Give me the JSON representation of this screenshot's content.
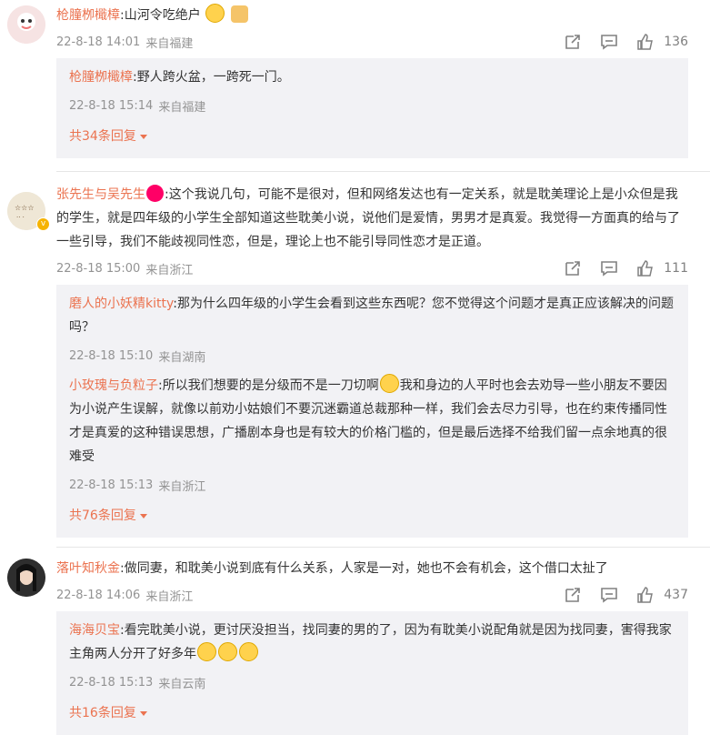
{
  "threads": [
    {
      "author": "枪膧栁檝樟",
      "body": ":山河令吃绝户",
      "time": "22-8-18 14:01",
      "source": "来自福建",
      "likes": "136",
      "avatar_color": "#f3d9d9",
      "replies": [
        {
          "author": "枪膧栁檝樟",
          "body": ":野人跨火盆，一跨死一门。",
          "time": "22-8-18 15:14",
          "source": "来自福建"
        }
      ],
      "more": "共34条回复"
    },
    {
      "author": "张先生与吴先生",
      "body": ":这个我说几句，可能不是很对，但和网络发达也有一定关系，就是耽美理论上是小众但是我的学生，就是四年级的小学生全部知道这些耽美小说，说他们是爱情，男男才是真爱。我觉得一方面真的给与了一些引导，我们不能歧视同性恋，但是，理论上也不能引导同性恋才是正道。",
      "time": "22-8-18 15:00",
      "source": "来自浙江",
      "likes": "111",
      "avatar_color": "#e8e0d0",
      "replies": [
        {
          "author": "磨人的小妖精kitty",
          "body": ":那为什么四年级的小学生会看到这些东西呢？您不觉得这个问题才是真正应该解决的问题吗？",
          "time": "22-8-18 15:10",
          "source": "来自湖南"
        },
        {
          "author": "小玫瑰与负粒子",
          "body": ":所以我们想要的是分级而不是一刀切啊",
          "body2": "我和身边的人平时也会去劝导一些小朋友不要因为小说产生误解，就像以前劝小姑娘们不要沉迷霸道总裁那种一样，我们会去尽力引导，也在约束传播同性才是真爱的这种错误思想，广播剧本身也是有较大的价格门槛的，但是最后选择不给我们留一点余地真的很难受",
          "time": "22-8-18 15:13",
          "source": "来自浙江"
        }
      ],
      "more": "共76条回复"
    },
    {
      "author": "落叶知秋金",
      "body": ":做同妻，和耽美小说到底有什么关系，人家是一对，她也不会有机会，这个借口太扯了",
      "time": "22-8-18 14:06",
      "source": "来自浙江",
      "likes": "437",
      "avatar_color": "#3a3a3a",
      "replies": [
        {
          "author": "海海贝宝",
          "body": ":看完耽美小说，更讨厌没担当，找同妻的男的了，因为有耽美小说配角就是因为找同妻，害得我家主角两人分开了好多年",
          "time": "22-8-18 15:13",
          "source": "来自云南"
        }
      ],
      "more": "共16条回复"
    }
  ],
  "icons": {
    "share": "share-icon",
    "comment": "comment-icon",
    "like": "like-icon"
  },
  "colors": {
    "name": "#eb7350",
    "meta": "#939393",
    "reply_bg": "#f2f2f5"
  }
}
